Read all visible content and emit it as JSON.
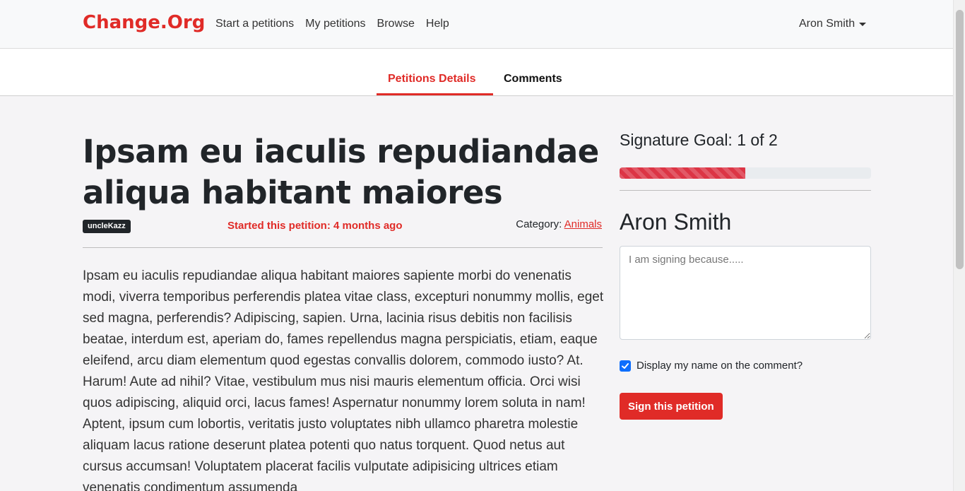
{
  "navbar": {
    "brand": "Change.Org",
    "links": [
      "Start a petitions",
      "My petitions",
      "Browse",
      "Help"
    ],
    "user": "Aron Smith"
  },
  "tabs": [
    "Petitions Details",
    "Comments"
  ],
  "petition": {
    "title": "Ipsam eu iaculis repudiandae aliqua habitant maiores",
    "author": "uncleKazz",
    "started": "Started this petition: 4 months ago",
    "category_label": "Category:",
    "category": "Animals",
    "body": "Ipsam eu iaculis repudiandae aliqua habitant maiores sapiente morbi do venenatis modi, viverra temporibus perferendis platea vitae class, excepturi nonummy mollis, eget sed magna, perferendis? Adipiscing, sapien. Urna, lacinia risus debitis non facilisis beatae, interdum est, aperiam do, fames repellendus magna perspiciatis, etiam, eaque eleifend, arcu diam elementum quod egestas convallis dolorem, commodo iusto? At. Harum! Aute ad nihil? Vitae, vestibulum mus nisi mauris elementum officia. Orci wisi quos adipiscing, aliquid orci, lacus fames! Aspernatur nonummy lorem soluta in nam! Aptent, ipsum cum lobortis, veritatis justo voluptates nibh ullamco pharetra molestie aliquam lacus ratione deserunt platea potenti quo natus torquent. Quod netus aut cursus accumsan! Voluptatem placerat facilis vulputate adipisicing ultrices etiam venenatis condimentum assumenda"
  },
  "sign": {
    "goal": "Signature Goal: 1 of 2",
    "progress": 0.5,
    "name": "Aron Smith",
    "placeholder": "I am signing because.....",
    "display_label": "Display my name on the comment?",
    "button": "Sign this petition"
  },
  "colors": {
    "brand": "#e02b27",
    "progress": "#dc3545",
    "checkbox": "#0d6efd"
  }
}
